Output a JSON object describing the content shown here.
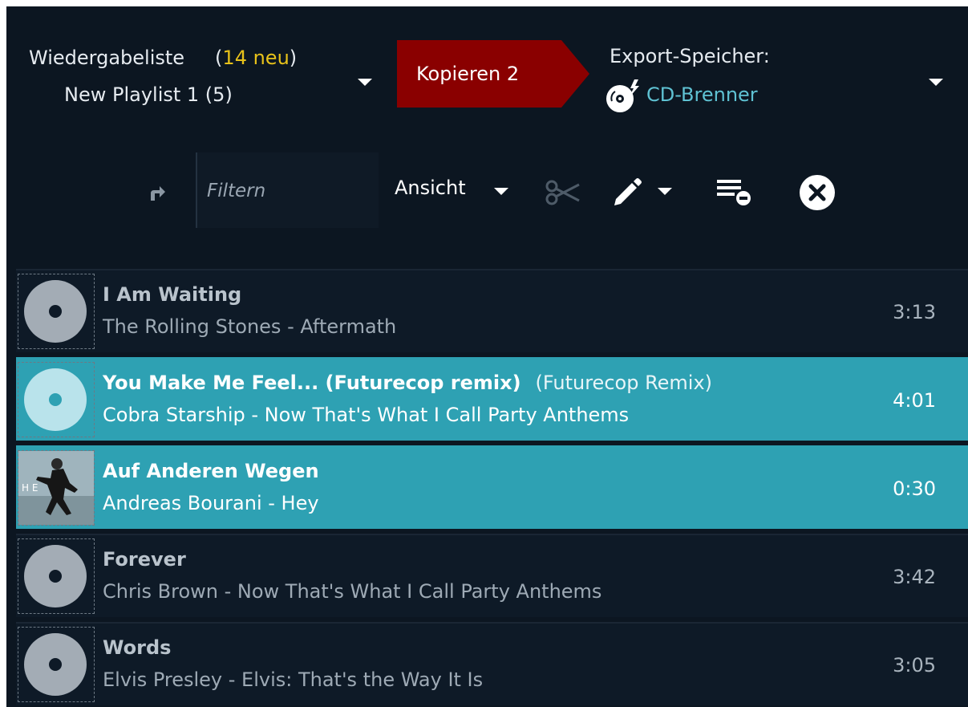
{
  "header": {
    "playlist_label": "Wiedergabeliste",
    "new_count": "14 neu",
    "playlist_name": "New Playlist 1 (5)",
    "copy_button": "Kopieren 2",
    "export_title": "Export-Speicher:",
    "export_device": "CD-Brenner"
  },
  "toolbar": {
    "filter_placeholder": "Filtern",
    "view_label": "Ansicht"
  },
  "icons": {
    "forward": "forward-arrow-icon",
    "cut": "scissors-icon",
    "edit": "pencil-icon",
    "remove": "list-remove-icon",
    "close": "close-circle-icon",
    "cd": "cd-burner-icon",
    "cover_placeholder": "disc-icon"
  },
  "colors": {
    "background": "#0c1621",
    "row": "#0e1a27",
    "selected_row": "#2ea1b3",
    "copy_button": "#8a0000",
    "new_count": "#e8c21a",
    "device": "#5fc2d3"
  },
  "tracks": [
    {
      "title": "I Am Waiting",
      "version": "",
      "subtitle": "The Rolling Stones - Aftermath",
      "duration": "3:13",
      "selected": false,
      "cover": "placeholder"
    },
    {
      "title": "You Make Me Feel... (Futurecop remix)",
      "version": "(Futurecop Remix)",
      "subtitle": "Cobra Starship - Now That's What I Call Party Anthems",
      "duration": "4:01",
      "selected": true,
      "cover": "placeholder"
    },
    {
      "title": "Auf Anderen Wegen",
      "version": "",
      "subtitle": "Andreas Bourani - Hey",
      "duration": "0:30",
      "selected": true,
      "cover": "album-art"
    },
    {
      "title": "Forever",
      "version": "",
      "subtitle": "Chris Brown - Now That's What I Call Party Anthems",
      "duration": "3:42",
      "selected": false,
      "cover": "placeholder"
    },
    {
      "title": "Words",
      "version": "",
      "subtitle": "Elvis Presley - Elvis: That's the Way It Is",
      "duration": "3:05",
      "selected": false,
      "cover": "placeholder"
    }
  ]
}
